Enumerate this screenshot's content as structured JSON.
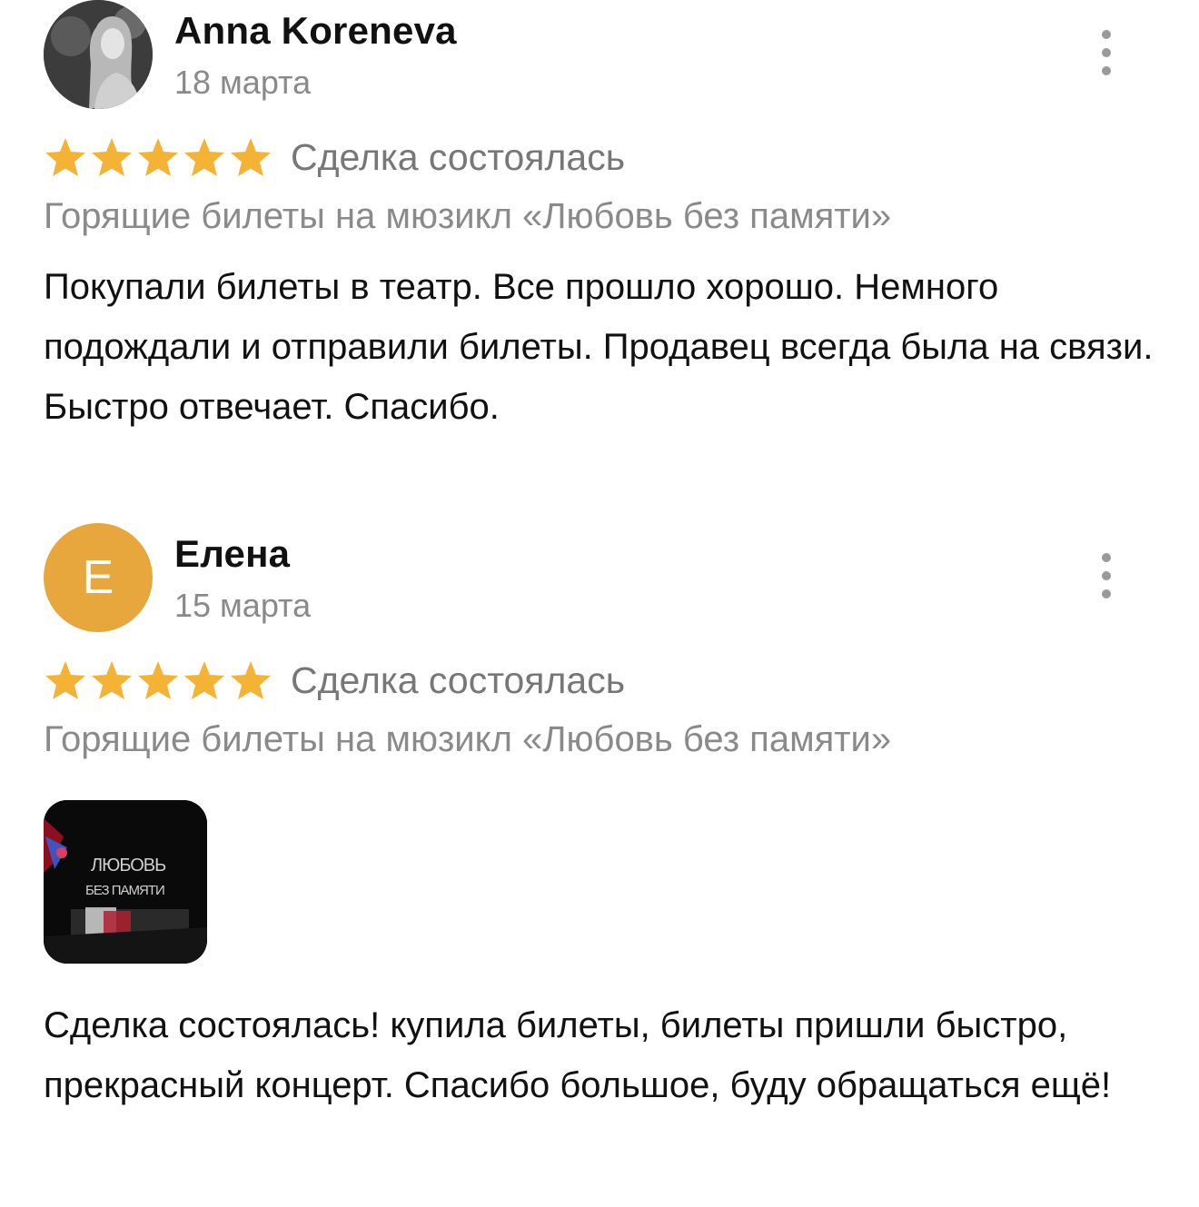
{
  "reviews": [
    {
      "author": "Anna Koreneva",
      "date": "18 марта",
      "avatar": {
        "type": "photo"
      },
      "rating": 5,
      "status": "Сделка состоялась",
      "item": "Горящие билеты на мюзикл «Любовь без памяти»",
      "text": "Покупали билеты в театр. Все прошло хорошо. Немного подождали и отправили билеты. Продавец всегда была на связи. Быстро отвечает. Спасибо.",
      "more_icon": "more-vertical-icon"
    },
    {
      "author": "Елена",
      "date": "15 марта",
      "avatar": {
        "type": "letter",
        "letter": "Е",
        "color": "#E8A73C"
      },
      "rating": 5,
      "status": "Сделка состоялась",
      "item": "Горящие билеты на мюзикл «Любовь без памяти»",
      "photo": {
        "caption_lines": [
          "ЛЮБОВЬ",
          "БЕЗ ПАМЯТИ"
        ]
      },
      "text": "Сделка состоялась! купила билеты, билеты пришли быстро, прекрасный концерт. Спасибо большое, буду обращаться ещё!",
      "more_icon": "more-vertical-icon"
    }
  ],
  "colors": {
    "star": "#F4B335",
    "muted_text": "#8A8A8A",
    "body_text": "#111111"
  }
}
